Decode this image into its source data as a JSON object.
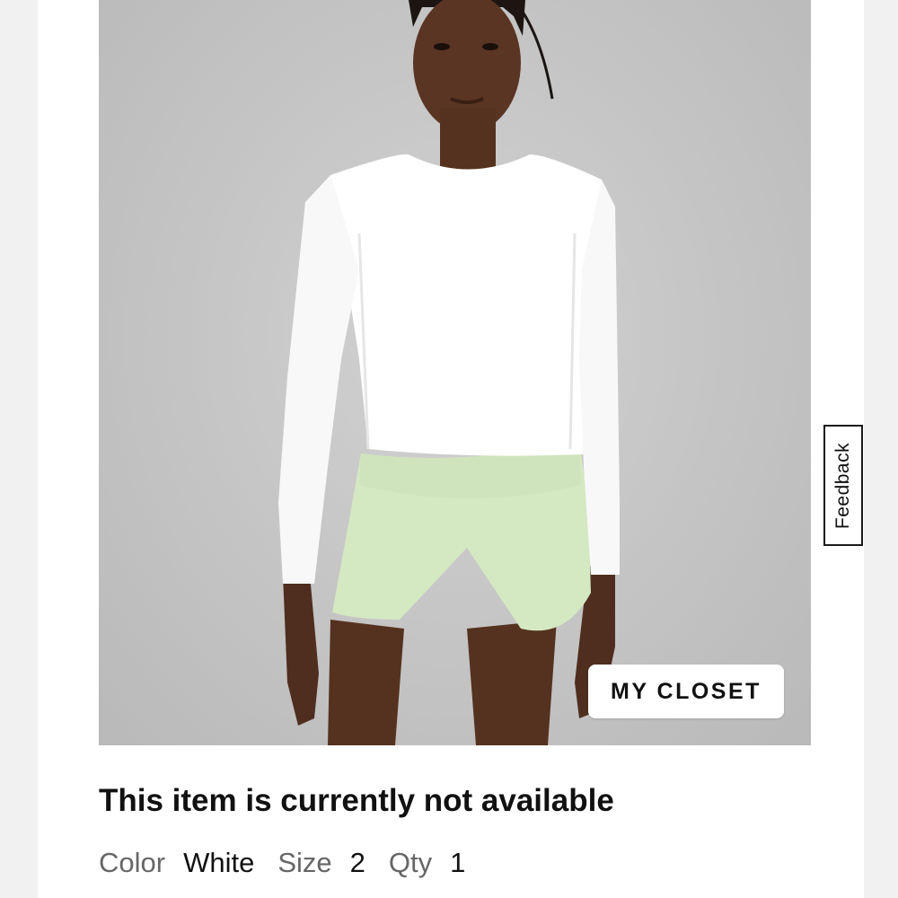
{
  "product": {
    "closet_button_label": "MY CLOSET",
    "availability_message": "This item is currently not available",
    "attributes": {
      "color_label": "Color",
      "color_value": "White",
      "size_label": "Size",
      "size_value": "2",
      "qty_label": "Qty",
      "qty_value": "1"
    }
  },
  "feedback": {
    "label": "Feedback"
  },
  "colors": {
    "background": "#f1f1f1",
    "panel": "#ffffff",
    "photo_backdrop": "#c4c4c4",
    "text_primary": "#111111",
    "text_muted": "#666666",
    "shorts": "#d4e8c2",
    "top": "#ffffff"
  }
}
